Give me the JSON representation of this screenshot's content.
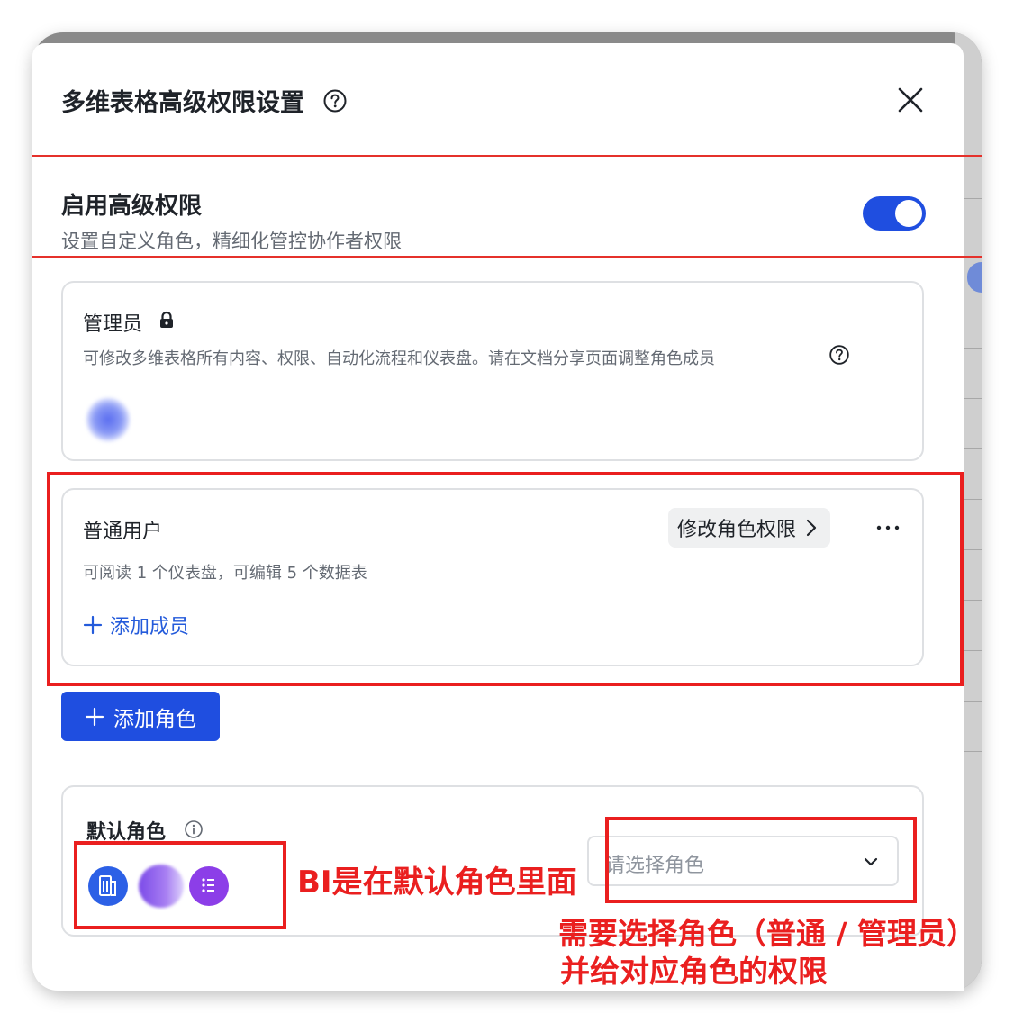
{
  "dialog": {
    "title": "多维表格高级权限设置",
    "close_icon": "close-icon",
    "help_icon": "help-circle-icon"
  },
  "advanced": {
    "title": "启用高级权限",
    "description": "设置自定义角色，精细化管控协作者权限",
    "toggle_on": true
  },
  "admin_role": {
    "name": "管理员",
    "lock_icon": "lock-icon",
    "description": "可修改多维表格所有内容、权限、自动化流程和仪表盘。请在文档分享页面调整角色成员"
  },
  "user_role": {
    "name": "普通用户",
    "modify_label": "修改角色权限",
    "description": "可阅读 1 个仪表盘，可编辑 5 个数据表",
    "add_member_label": "添加成员"
  },
  "add_role_label": "添加角色",
  "default_role": {
    "title": "默认角色",
    "select_placeholder": "请选择角色"
  },
  "annotations": {
    "bi_note": "BI是在默认角色里面",
    "select_note_line1": "需要选择角色（普通 / 管理员）",
    "select_note_line2": "并给对应角色的权限"
  },
  "colors": {
    "primary": "#1f4ee0",
    "annotation_red": "#ea1f1f"
  }
}
